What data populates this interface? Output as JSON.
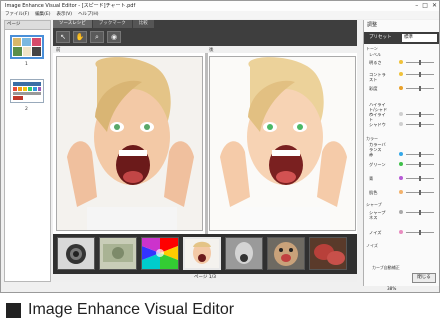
{
  "window": {
    "title": "Image Enhance Visual Editor - [スピード]チャート.pdf",
    "minimize": "–",
    "maximize": "□",
    "close": "✕"
  },
  "menu": [
    "ファイル(F)",
    "編集(E)",
    "表示(V)",
    "ヘルプ(H)"
  ],
  "pages_panel": {
    "title": "ページ",
    "page1": "1",
    "page2": "2"
  },
  "toolbar": {
    "tabs": [
      "ソースレシピ",
      "ブックマーク",
      "比較"
    ],
    "tools": [
      "select-icon",
      "hand-icon",
      "zoom-icon",
      "eye-icon"
    ]
  },
  "panes": {
    "before_label": "前",
    "after_label": "後"
  },
  "pager": {
    "text": "ページ 1/3"
  },
  "adjust": {
    "title": "調整",
    "preset_label": "プリセット",
    "preset_value": "標準",
    "tone_group": "トーン",
    "level": "レベル",
    "controls": [
      {
        "label": "明るさ",
        "color": "#f0c23a",
        "level": 0.5
      },
      {
        "label": "コントラスト",
        "color": "#f0c23a",
        "level": 0.5
      },
      {
        "label": "彩度",
        "color": "#e9a12a",
        "level": 0.5
      },
      {
        "label": "ハイライト/シャドウ",
        "color": "",
        "level": 0.5
      },
      {
        "label": "ハイライト",
        "color": "#cfcfcf",
        "level": 0.5
      },
      {
        "label": "シャドウ",
        "color": "#cfcfcf",
        "level": 0.5
      },
      {
        "label": "カラーバランス",
        "color": "",
        "level": 0.5
      },
      {
        "label": "赤",
        "color": "#35a8e8",
        "level": 0.5
      },
      {
        "label": "グリーン",
        "color": "#3fc04a",
        "level": 0.5
      },
      {
        "label": "青",
        "color": "#b65ad6",
        "level": 0.5
      },
      {
        "label": "肌色",
        "color": "#f3b26c",
        "level": 0.5
      },
      {
        "label": "シャープネス",
        "color": "#aaaaaa",
        "level": 0.5
      },
      {
        "label": "ノイズ",
        "color": "#e88cc0",
        "level": 0.5
      }
    ],
    "color_group": "カラー",
    "sharp_group": "シャープ",
    "noise_group": "ノイズ",
    "noise_option": "カーブ自動補正",
    "ok": "閉じる"
  },
  "status": {
    "zoom": "38%"
  },
  "caption": "Image Enhance Visual Editor"
}
